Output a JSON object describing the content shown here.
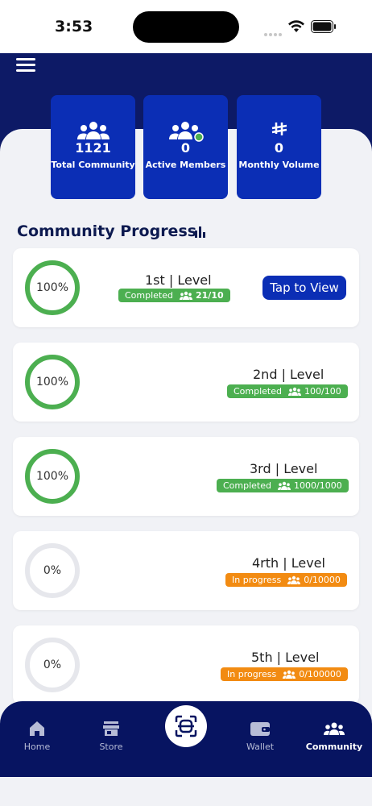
{
  "status_bar": {
    "time": "3:53"
  },
  "stats": [
    {
      "value": "1121",
      "label": "Total Community",
      "icon": "users-icon"
    },
    {
      "value": "0",
      "label": "Active Members",
      "icon": "users-online-icon"
    },
    {
      "value": "0",
      "label": "Monthly Volume",
      "icon": "currency-icon"
    }
  ],
  "section": {
    "title": "Community Progress",
    "icon": "bar-chart-icon"
  },
  "levels": [
    {
      "percent": "100%",
      "name": "1st | Level",
      "status": "Completed",
      "count": "21/10",
      "state": "completed"
    },
    {
      "percent": "100%",
      "name": "2nd | Level",
      "status": "Completed",
      "count": "100/100",
      "state": "completed"
    },
    {
      "percent": "100%",
      "name": "3rd | Level",
      "status": "Completed",
      "count": "1000/1000",
      "state": "completed"
    },
    {
      "percent": "0%",
      "name": "4rth | Level",
      "status": "In progress",
      "count": "0/10000",
      "state": "in-progress"
    },
    {
      "percent": "0%",
      "name": "5th | Level",
      "status": "In progress",
      "count": "0/100000",
      "state": "in-progress"
    }
  ],
  "tap_button": "Tap to View",
  "nav": [
    {
      "label": "Home",
      "icon": "home-icon"
    },
    {
      "label": "Store",
      "icon": "store-icon"
    },
    {
      "label": "Wallet",
      "icon": "wallet-icon"
    },
    {
      "label": "Community",
      "icon": "community-icon",
      "active": true
    }
  ],
  "colors": {
    "header": "#0d1a66",
    "card_blue": "#0b2eb5",
    "completed": "#4caf50",
    "in_progress": "#f28b12",
    "nav": "#071461"
  }
}
